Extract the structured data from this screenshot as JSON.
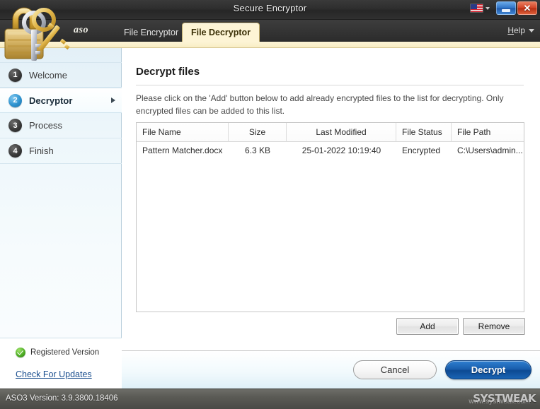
{
  "window": {
    "title": "Secure Encryptor",
    "minimize_icon": "minimize-icon",
    "close_icon": "close-icon",
    "language_flag": "us-flag-icon"
  },
  "tabbar": {
    "brand": "aso",
    "tabs": [
      {
        "label": "File Encryptor",
        "active": false
      },
      {
        "label": "File Decryptor",
        "active": true
      }
    ],
    "help_label": "Help"
  },
  "sidebar": {
    "items": [
      {
        "number": "1",
        "label": "Welcome",
        "active": false
      },
      {
        "number": "2",
        "label": "Decryptor",
        "active": true
      },
      {
        "number": "3",
        "label": "Process",
        "active": false
      },
      {
        "number": "4",
        "label": "Finish",
        "active": false
      }
    ],
    "registered_label": "Registered Version",
    "check_updates_label": "Check For Updates"
  },
  "main": {
    "heading": "Decrypt files",
    "description": "Please click on the 'Add' button below to add already encrypted files to the list for decrypting. Only encrypted files can be added to this list.",
    "table": {
      "columns": [
        "File Name",
        "Size",
        "Last Modified",
        "File Status",
        "File Path"
      ],
      "rows": [
        {
          "file_name": "Pattern Matcher.docx",
          "size": "6.3 KB",
          "last_modified": "25-01-2022 10:19:40",
          "file_status": "Encrypted",
          "file_path": "C:\\Users\\admin..."
        }
      ]
    },
    "add_label": "Add",
    "remove_label": "Remove"
  },
  "footer": {
    "cancel_label": "Cancel",
    "decrypt_label": "Decrypt"
  },
  "statusbar": {
    "version_text": "ASO3 Version: 3.9.3800.18406",
    "watermark": "SYSTWEAK",
    "watermark_sub": "www.systweak.com"
  },
  "colors": {
    "accent_blue": "#1a5fae",
    "tab_active_bg": "#fdf4d5",
    "titlebar_bg": "#2e2e2e",
    "sidebar_bg": "#e3f0f7",
    "close_red": "#d34325"
  }
}
